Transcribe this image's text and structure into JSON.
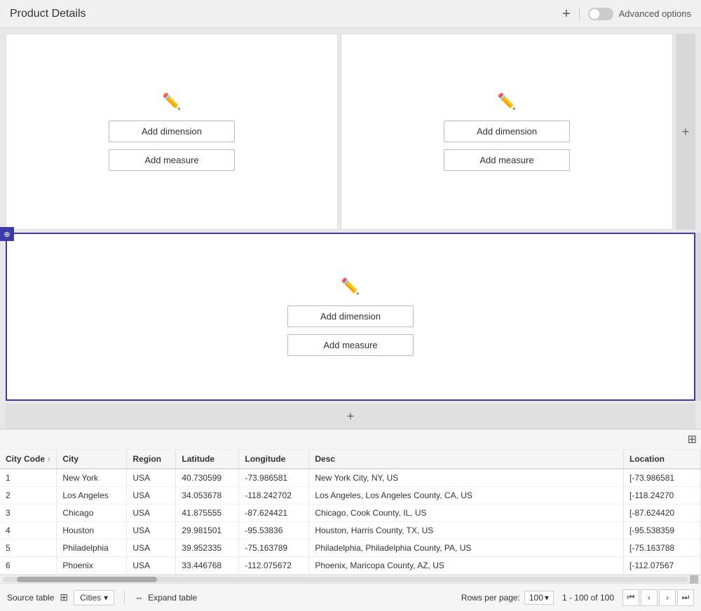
{
  "header": {
    "title": "Product Details",
    "plus_label": "+",
    "advanced_options_label": "Advanced options"
  },
  "panels": {
    "top_left": {
      "add_dimension_label": "Add dimension",
      "add_measure_label": "Add measure"
    },
    "top_right": {
      "add_dimension_label": "Add dimension",
      "add_measure_label": "Add measure"
    },
    "bottom": {
      "add_dimension_label": "Add dimension",
      "add_measure_label": "Add measure"
    }
  },
  "table": {
    "columns": [
      {
        "key": "city_code",
        "label": "City Code",
        "sortable": true,
        "sort_dir": "asc"
      },
      {
        "key": "city",
        "label": "City"
      },
      {
        "key": "region",
        "label": "Region"
      },
      {
        "key": "latitude",
        "label": "Latitude"
      },
      {
        "key": "longitude",
        "label": "Longitude"
      },
      {
        "key": "desc",
        "label": "Desc"
      },
      {
        "key": "location",
        "label": "Location"
      }
    ],
    "rows": [
      {
        "city_code": "1",
        "city": "New York",
        "region": "USA",
        "latitude": "40.730599",
        "longitude": "-73.986581",
        "desc": "New York City, NY, US",
        "location": "[-73.986581"
      },
      {
        "city_code": "2",
        "city": "Los Angeles",
        "region": "USA",
        "latitude": "34.053678",
        "longitude": "-118.242702",
        "desc": "Los Angeles, Los Angeles County, CA, US",
        "location": "[-118.24270"
      },
      {
        "city_code": "3",
        "city": "Chicago",
        "region": "USA",
        "latitude": "41.875555",
        "longitude": "-87.624421",
        "desc": "Chicago, Cook County, IL, US",
        "location": "[-87.624420"
      },
      {
        "city_code": "4",
        "city": "Houston",
        "region": "USA",
        "latitude": "29.981501",
        "longitude": "-95.53836",
        "desc": "Houston, Harris County, TX, US",
        "location": "[-95.538359"
      },
      {
        "city_code": "5",
        "city": "Philadelphia",
        "region": "USA",
        "latitude": "39.952335",
        "longitude": "-75.163789",
        "desc": "Philadelphia, Philadelphia County, PA, US",
        "location": "[-75.163788"
      },
      {
        "city_code": "6",
        "city": "Phoenix",
        "region": "USA",
        "latitude": "33.446768",
        "longitude": "-112.075672",
        "desc": "Phoenix, Maricopa County, AZ, US",
        "location": "[-112.07567"
      }
    ]
  },
  "footer": {
    "source_label": "Source table",
    "table_name": "Cities",
    "expand_label": "Expand table",
    "rows_per_page_label": "Rows per page:",
    "rows_per_page_value": "100",
    "pagination_info": "1 - 100 of 100"
  }
}
